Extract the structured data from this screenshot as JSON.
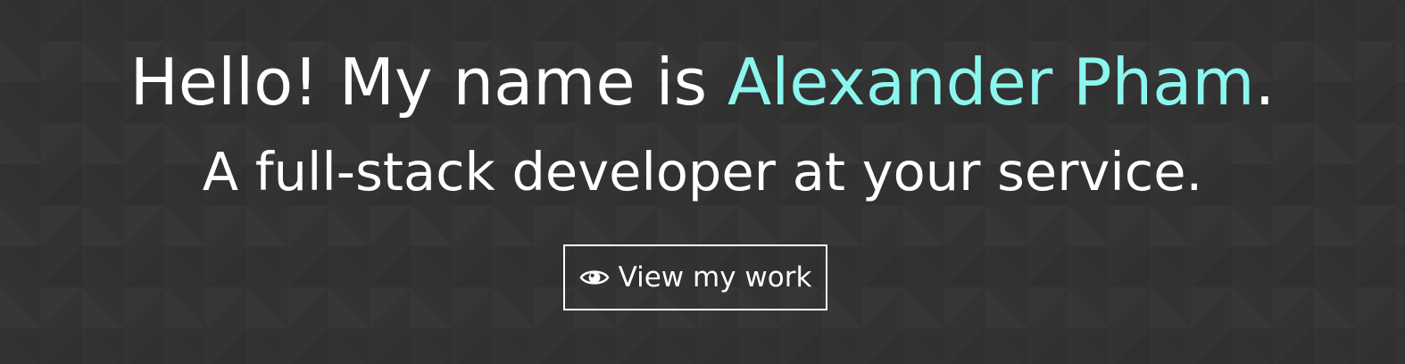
{
  "hero": {
    "headline": {
      "prefix": "Hello! My name is ",
      "name": "Alexander Pham",
      "suffix": "."
    },
    "tagline": "A full-stack developer at your service.",
    "cta": {
      "icon": "eye-icon",
      "label": "View my work"
    }
  },
  "colors": {
    "background": "#333333",
    "text": "#ffffff",
    "accent": "#8cf6ee"
  }
}
